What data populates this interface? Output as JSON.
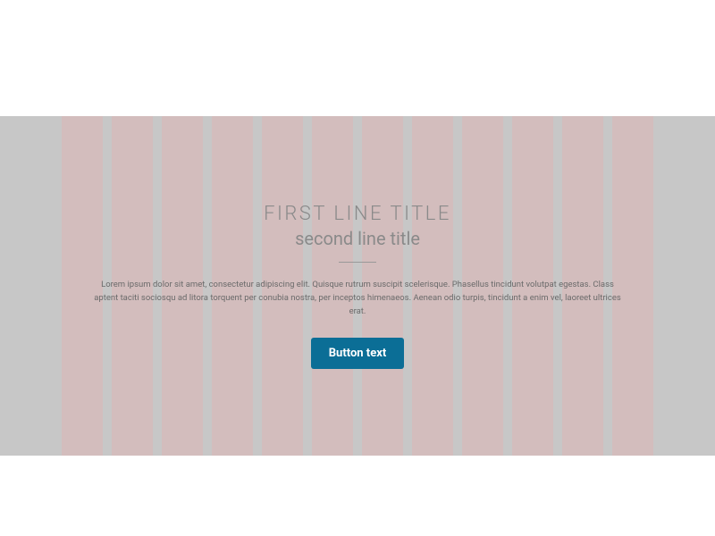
{
  "hero": {
    "title_first_line": "FIRST LINE TITLE",
    "title_second_line": "second line title",
    "body_text": "Lorem ipsum dolor sit amet, consectetur adipiscing elit. Quisque rutrum suscipit scelerisque. Phasellus tincidunt volutpat egestas. Class aptent taciti sociosqu ad litora torquent per conubia nostra, per inceptos himenaeos. Aenean odio turpis, tincidunt a enim vel, laoreet ultrices erat.",
    "button_label": "Button text"
  },
  "layout": {
    "grid_columns": 12
  }
}
